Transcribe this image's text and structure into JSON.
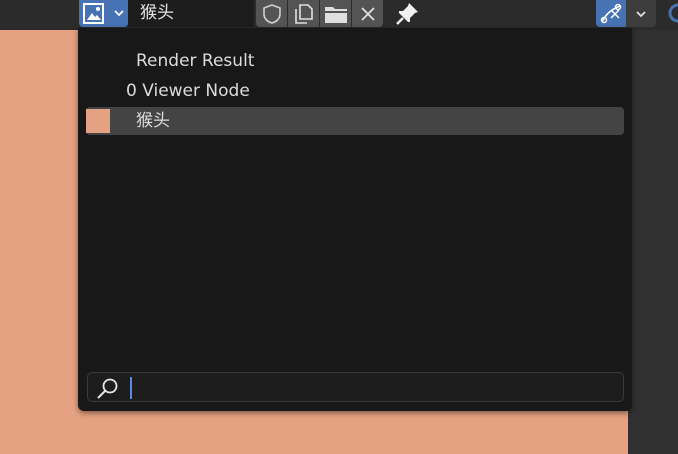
{
  "colors": {
    "canvas": "#e5a282",
    "swatch": "#e5a282",
    "accent": "#4772b3",
    "popup_bg": "#181818",
    "selected_row": "#444444"
  },
  "header": {
    "image_name": "猴头",
    "icons": {
      "browse": "image-browse-icon",
      "fake_user": "shield-icon",
      "duplicate": "duplicate-icon",
      "open": "folder-icon",
      "unlink": "close-icon",
      "pin": "pin-icon",
      "view": "sample-tool-icon",
      "view_menu": "chevron-down-icon"
    }
  },
  "popup": {
    "items": [
      {
        "label": "Render Result"
      },
      {
        "label": "0 Viewer Node"
      },
      {
        "label": "猴头",
        "selected": true
      }
    ],
    "search": {
      "value": "",
      "placeholder": ""
    }
  }
}
